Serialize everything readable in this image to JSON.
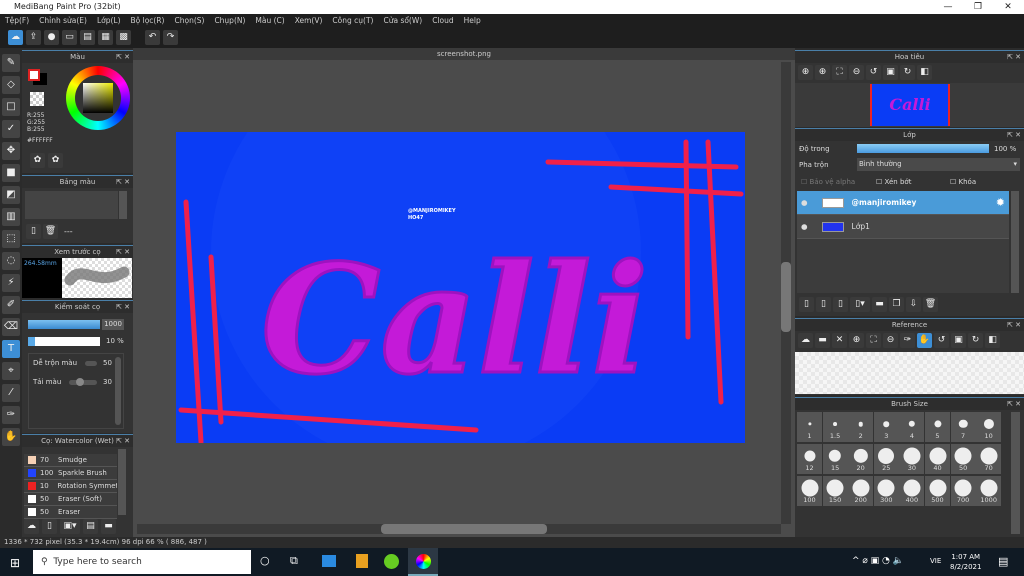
{
  "app": {
    "title": "MediBang Paint Pro (32bit)"
  },
  "menu": [
    "Tệp(F)",
    "Chỉnh sửa(E)",
    "Lớp(L)",
    "Bộ lọc(R)",
    "Chọn(S)",
    "Chụp(N)",
    "Màu (C)",
    "Xem(V)",
    "Công cụ(T)",
    "Cửa sổ(W)",
    "Cloud",
    "Help"
  ],
  "color_panel": {
    "title": "Màu",
    "r": "R:255",
    "g": "G:255",
    "b": "B:255",
    "hex": "#FFFFFF",
    "accent": "#3d8fd6"
  },
  "palette_panel": {
    "title": "Bảng màu",
    "dash": "---"
  },
  "preview_panel": {
    "title": "Xem trước cọ",
    "size": "264.58mm"
  },
  "brush_control": {
    "title": "Kiểm soát cọ",
    "size": "1000",
    "opacity": "10 %",
    "opacity_fraction": 0.1,
    "blend_label": "Dễ trộn màu",
    "blend_value": "50",
    "load_label": "Tải màu",
    "load_value": "30"
  },
  "brush_list": {
    "title": "Cọ: Watercolor (Wet)",
    "items": [
      {
        "size": "70",
        "name": "Smudge",
        "color": "#f5d0b5"
      },
      {
        "size": "100",
        "name": "Sparkle Brush",
        "color": "#2244ff"
      },
      {
        "size": "10",
        "name": "Rotation Symmet",
        "color": "#ee2222"
      },
      {
        "size": "50",
        "name": "Eraser (Soft)",
        "color": "#ffffff"
      },
      {
        "size": "50",
        "name": "Eraser",
        "color": "#ffffff"
      }
    ]
  },
  "document": {
    "tab": "screenshot.png",
    "artwork_text": "Calli",
    "watermark_1": "@MANJIROMIKEY",
    "watermark_2": "HO47",
    "bg": "#0a3cf5"
  },
  "navigator": {
    "title": "Hoa tiêu"
  },
  "layers": {
    "title": "Lớp",
    "opacity_label": "Độ trong",
    "opacity": "100 %",
    "blend_label": "Pha trộn",
    "blend_value": "Bình thường",
    "alpha_label": "Bảo vệ alpha",
    "clip_label": "Xén bớt",
    "lock_label": "Khóa",
    "items": [
      {
        "name": "@manjiromikey",
        "selected": true
      },
      {
        "name": "Lớp1",
        "selected": false
      }
    ]
  },
  "reference": {
    "title": "Reference"
  },
  "brush_size": {
    "title": "Brush Size",
    "sizes": [
      "1",
      "1.5",
      "2",
      "3",
      "4",
      "5",
      "7",
      "10",
      "12",
      "15",
      "20",
      "25",
      "30",
      "40",
      "50",
      "70",
      "100",
      "150",
      "200",
      "300",
      "400",
      "500",
      "700",
      "1000"
    ]
  },
  "status": "1336 * 732 pixel   (35.3 * 19.4cm)  96 dpi   66 %   ( 886, 487 )",
  "taskbar": {
    "search_placeholder": "Type here to search",
    "lang": "VIE",
    "time": "1:07 AM",
    "date": "8/2/2021"
  }
}
